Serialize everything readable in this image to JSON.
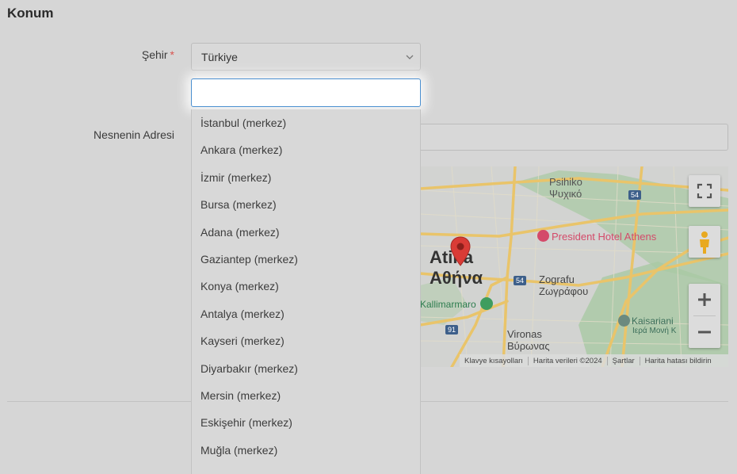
{
  "section": {
    "title": "Konum"
  },
  "city": {
    "label": "Şehir",
    "required_mark": "*",
    "selected": "Türkiye",
    "search_value": "",
    "options": [
      "İstanbul (merkez)",
      "Ankara (merkez)",
      "İzmir (merkez)",
      "Bursa (merkez)",
      "Adana (merkez)",
      "Gaziantep (merkez)",
      "Konya (merkez)",
      "Antalya (merkez)",
      "Kayseri (merkez)",
      "Diyarbakır (merkez)",
      "Mersin (merkez)",
      "Eskişehir (merkez)",
      "Muğla (merkez)"
    ]
  },
  "address": {
    "label": "Nesnenin Adresi",
    "value": ""
  },
  "map": {
    "places": {
      "psihiko_latin": "Psihiko",
      "psihiko_greek": "Ψυχικό",
      "hotel": "President Hotel Athens",
      "athens_latin": "Atina",
      "athens_greek": "Αθήνα",
      "kallimarmaro": "Kallimarmaro",
      "zografu_latin": "Zografu",
      "zografu_greek": "Ζωγράφου",
      "vironas_latin": "Vironas",
      "vironas_greek": "Βύρωνας",
      "kaisariani_latin": "Kaisariani",
      "kaisariani_greek": "Ιερά Μονή Κ",
      "road_54a": "54",
      "road_54b": "54",
      "road_91": "91"
    },
    "footer": {
      "shortcuts": "Klavye kısayolları",
      "map_data": "Harita verileri ©2024",
      "terms": "Şartlar",
      "report": "Harita hatası bildirin"
    },
    "colors": {
      "pin": "#d93b36",
      "hotel": "#d44a6a",
      "road": "#e9c46a",
      "park": "#a9c9a4"
    }
  }
}
